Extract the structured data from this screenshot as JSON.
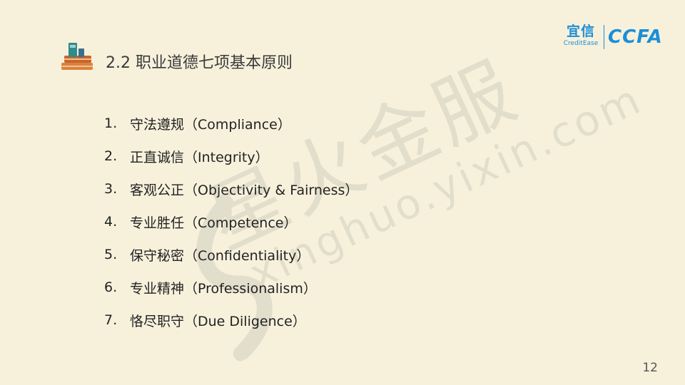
{
  "slide": {
    "title": "2.2 职业道德七项基本原则",
    "page_number": "12"
  },
  "logo": {
    "brand_cn": "宜信",
    "brand_en": "CreditEase",
    "partner": "CCFA"
  },
  "watermark": {
    "text_cn": "星火金服",
    "url": "xinghuo.yixin.com"
  },
  "principles": [
    {
      "num": "1.",
      "text": "守法遵规（Compliance）"
    },
    {
      "num": "2.",
      "text": "正直诚信（Integrity）"
    },
    {
      "num": "3.",
      "text": "客观公正（Objectivity & Fairness）"
    },
    {
      "num": "4.",
      "text": "专业胜任（Competence）"
    },
    {
      "num": "5.",
      "text": "保守秘密（Confidentiality）"
    },
    {
      "num": "6.",
      "text": "专业精神（Professionalism）"
    },
    {
      "num": "7.",
      "text": "恪尽职守（Due Diligence）"
    }
  ],
  "colors": {
    "background": "#f7f1dc",
    "brand_blue": "#1c8fd6",
    "book_orange": "#d9823f",
    "book_teal": "#2f8c8a"
  },
  "icons": {
    "title_icon": "books-icon"
  }
}
